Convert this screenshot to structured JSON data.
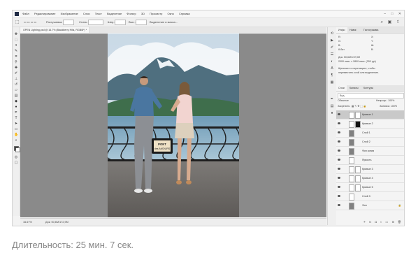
{
  "menubar": {
    "items": [
      "Файл",
      "Редактирование",
      "Изображение",
      "Слои",
      "Текст",
      "Выделение",
      "Фильтр",
      "3D",
      "Просмотр",
      "Окно",
      "Справка"
    ],
    "window_controls": [
      "–",
      "□",
      "✕"
    ]
  },
  "options_bar": {
    "feather_label": "Растушевка:",
    "style_label": "Стиль:",
    "width_label": "Шир.:",
    "height_label": "Выс.:",
    "refine_label": "Выделение и маска..."
  },
  "document_tab": {
    "label": "OPEN Lighting.psd @ 16.7% (Blackberry Hills, RGB/8*) *"
  },
  "statusbar": {
    "zoom": "16.67%",
    "doc_size": "Док: 50,6M/172,9M"
  },
  "photo": {
    "sign_line1": "PONT",
    "sign_line2": "des AMOURS"
  },
  "info_panel": {
    "tabs": [
      "Инфо",
      "Навиг.",
      "Гистограмма"
    ],
    "lines": [
      "R:",
      "G:",
      "B:",
      "8-бит",
      "X:",
      "Y:",
      "Ш:",
      "В:",
      "Док: 50,6M/172,9M",
      "2000 пикс. x 2800 пикс. (300 ppi)",
      "Щелкните и перетащите, чтобы",
      "переместить слой или выделение."
    ]
  },
  "layers_panel": {
    "tabs": [
      "Слои",
      "Каналы",
      "Контуры"
    ],
    "search_placeholder": "Вид",
    "blend_mode": "Обычные",
    "opacity_label": "Непрозр.: 100%",
    "lock_label": "Закрепить:",
    "fill_label": "Заливка: 100%",
    "layers": [
      {
        "name": "Кривые 1",
        "selected": true,
        "thumb": "white",
        "mask": "white"
      },
      {
        "name": "Кривые 2",
        "selected": false,
        "thumb": "white",
        "mask": "black"
      },
      {
        "name": "Слой 1",
        "selected": false,
        "thumb": "grey",
        "mask": "none"
      },
      {
        "name": "Слой 2",
        "selected": false,
        "thumb": "grey",
        "mask": "none"
      },
      {
        "name": "Фон копия",
        "selected": false,
        "thumb": "grey",
        "mask": "none"
      },
      {
        "name": "Яркость",
        "selected": false,
        "thumb": "white",
        "mask": "none"
      },
      {
        "name": "Кривые 3",
        "selected": false,
        "thumb": "white",
        "mask": "white"
      },
      {
        "name": "Кривые 4",
        "selected": false,
        "thumb": "white",
        "mask": "white"
      },
      {
        "name": "Кривые 5",
        "selected": false,
        "thumb": "white",
        "mask": "white"
      },
      {
        "name": "Слой 3",
        "selected": false,
        "thumb": "white",
        "mask": "none"
      },
      {
        "name": "Фон",
        "selected": false,
        "thumb": "grey",
        "mask": "none"
      }
    ]
  },
  "caption": {
    "text": "Длительность: 25 мин. 7 сек."
  }
}
